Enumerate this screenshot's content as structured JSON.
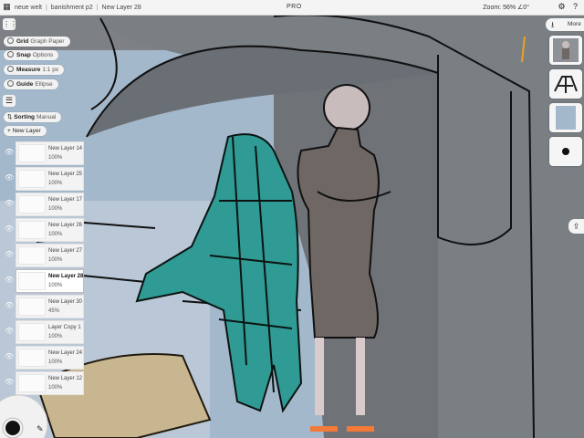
{
  "topbar": {
    "breadcrumb": [
      "neue welt",
      "banishment p2",
      "New Layer 28"
    ],
    "center": "PRO",
    "zoom": "Zoom: 56% ∠0°"
  },
  "toolbar": {
    "grid": {
      "key": "Grid",
      "value": "Graph Paper"
    },
    "snap": {
      "key": "Snap",
      "value": "Options"
    },
    "measure": {
      "key": "Measure",
      "value": "1:1 px"
    },
    "guide": {
      "key": "Guide",
      "value": "Ellipse"
    },
    "sorting": {
      "key": "Sorting",
      "value": "Manual"
    },
    "new_layer": "New Layer"
  },
  "layers": [
    {
      "name": "New Layer 14",
      "opacity": "100%",
      "selected": false
    },
    {
      "name": "New Layer 25",
      "opacity": "100%",
      "selected": false
    },
    {
      "name": "New Layer 17",
      "opacity": "100%",
      "selected": false
    },
    {
      "name": "New Layer 26",
      "opacity": "100%",
      "selected": false
    },
    {
      "name": "New Layer 27",
      "opacity": "100%",
      "selected": false
    },
    {
      "name": "New Layer 28",
      "opacity": "100%",
      "selected": true
    },
    {
      "name": "New Layer 30",
      "opacity": "45%",
      "selected": false
    },
    {
      "name": "Layer Copy 1",
      "opacity": "100%",
      "selected": false
    },
    {
      "name": "New Layer 24",
      "opacity": "100%",
      "selected": false
    },
    {
      "name": "New Layer 12",
      "opacity": "100%",
      "selected": false
    }
  ],
  "right_panel": {
    "more": "More"
  },
  "icons": [
    "grid-icon",
    "hamburger-icon",
    "eye-icon",
    "download-icon",
    "share-icon",
    "settings-icon",
    "help-icon",
    "sort-icon",
    "add-icon"
  ]
}
